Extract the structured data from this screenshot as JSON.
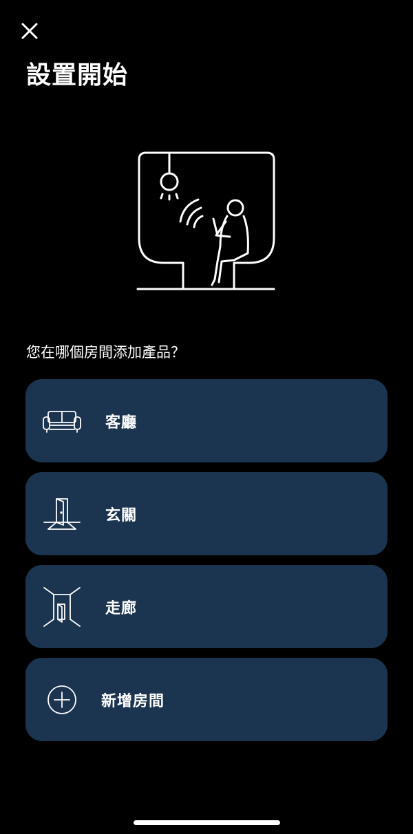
{
  "header": {
    "close_icon": "close-icon",
    "title": "設置開始"
  },
  "hero": {
    "icon": "person-room-speaker-illustration"
  },
  "question": "您在哪個房間添加產品？",
  "rooms": [
    {
      "label": "客廳",
      "icon": "sofa-icon"
    },
    {
      "label": "玄關",
      "icon": "entrance-door-icon"
    },
    {
      "label": "走廊",
      "icon": "hallway-icon"
    },
    {
      "label": "新增房間",
      "icon": "plus-circle-icon"
    }
  ],
  "colors": {
    "background": "#000000",
    "card": "#1b344f",
    "text": "#ffffff"
  }
}
